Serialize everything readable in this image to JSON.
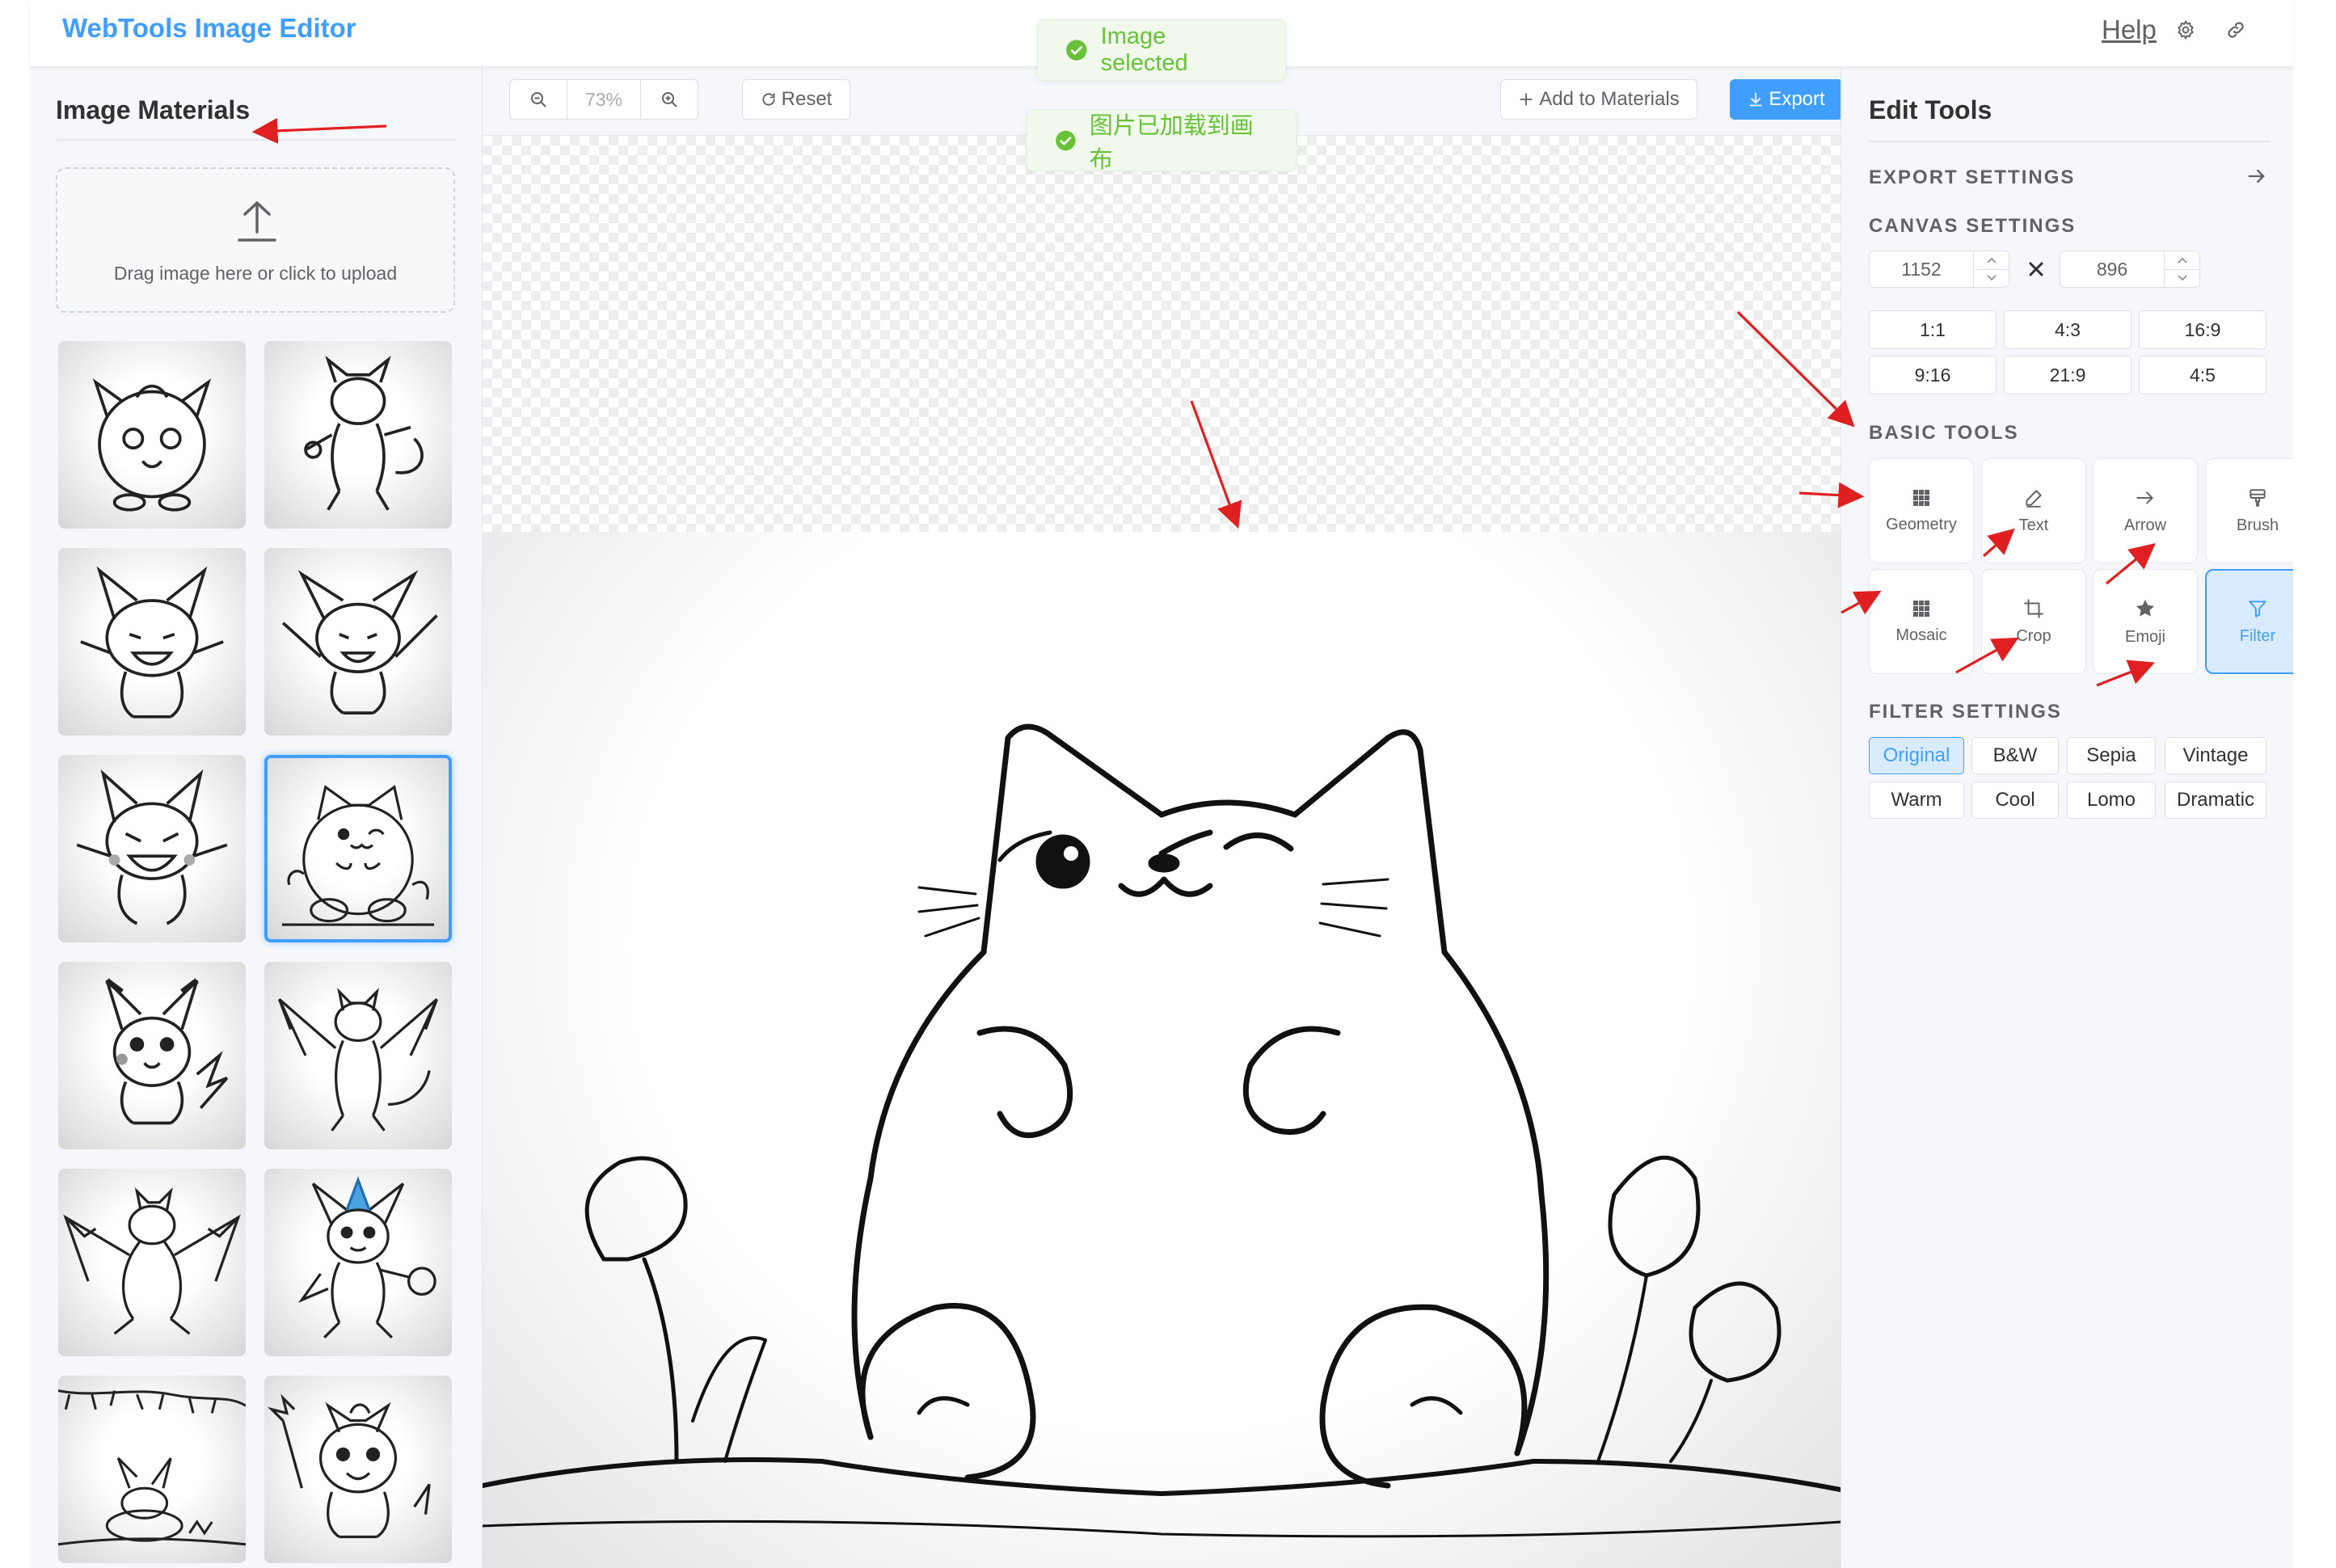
{
  "header": {
    "brand": "WebTools Image Editor",
    "help_label": "Help",
    "icons": [
      "gear-icon",
      "link-icon"
    ]
  },
  "left_panel": {
    "title": "Image Materials",
    "upload_text": "Drag image here or click to upload",
    "upload_icon": "upload-icon",
    "thumbnails": [
      {
        "subject": "jigglypuff-sketch"
      },
      {
        "subject": "mewtwo-sketch"
      },
      {
        "subject": "angry-pikachu-sketch"
      },
      {
        "subject": "pikachu-cheer-sketch"
      },
      {
        "subject": "gengar-pikachu-sketch"
      },
      {
        "subject": "chubby-cat-sketch",
        "selected": true
      },
      {
        "subject": "pikachu-sketch"
      },
      {
        "subject": "charizard-sketch"
      },
      {
        "subject": "dragon-sketch"
      },
      {
        "subject": "fox-creature-sketch"
      },
      {
        "subject": "sleeping-pikachu-sketch"
      },
      {
        "subject": "pikachu-flower-sketch"
      }
    ]
  },
  "toolbar": {
    "zoom_out_icon": "zoom-out-icon",
    "zoom_value": "73%",
    "zoom_in_icon": "zoom-in-icon",
    "reset_label": "Reset",
    "add_materials_label": "Add to Materials",
    "export_label": "Export"
  },
  "toasts": [
    "Image selected",
    "图片已加载到画布"
  ],
  "canvas": {
    "image": "chubby-cat-sketch"
  },
  "right_panel": {
    "title": "Edit Tools",
    "export_settings_label": "EXPORT SETTINGS",
    "canvas_settings_label": "CANVAS SETTINGS",
    "width": "1152",
    "height": "896",
    "times_symbol": "×",
    "ratios": [
      "1:1",
      "4:3",
      "16:9",
      "9:16",
      "21:9",
      "4:5"
    ],
    "basic_tools_label": "BASIC TOOLS",
    "tools": [
      {
        "label": "Geometry",
        "icon": "grid-icon"
      },
      {
        "label": "Text",
        "icon": "pencil-icon"
      },
      {
        "label": "Arrow",
        "icon": "arrow-right-icon"
      },
      {
        "label": "Brush",
        "icon": "brush-icon"
      },
      {
        "label": "Mosaic",
        "icon": "mosaic-icon"
      },
      {
        "label": "Crop",
        "icon": "crop-icon"
      },
      {
        "label": "Emoji",
        "icon": "star-icon"
      },
      {
        "label": "Filter",
        "icon": "filter-icon",
        "active": true
      }
    ],
    "filter_settings_label": "FILTER SETTINGS",
    "filters": [
      {
        "label": "Original",
        "active": true
      },
      {
        "label": "B&W"
      },
      {
        "label": "Sepia"
      },
      {
        "label": "Vintage"
      },
      {
        "label": "Warm"
      },
      {
        "label": "Cool"
      },
      {
        "label": "Lomo"
      },
      {
        "label": "Dramatic"
      }
    ]
  },
  "colors": {
    "accent": "#409eff",
    "success": "#67c23a",
    "annotation": "#e02020"
  }
}
